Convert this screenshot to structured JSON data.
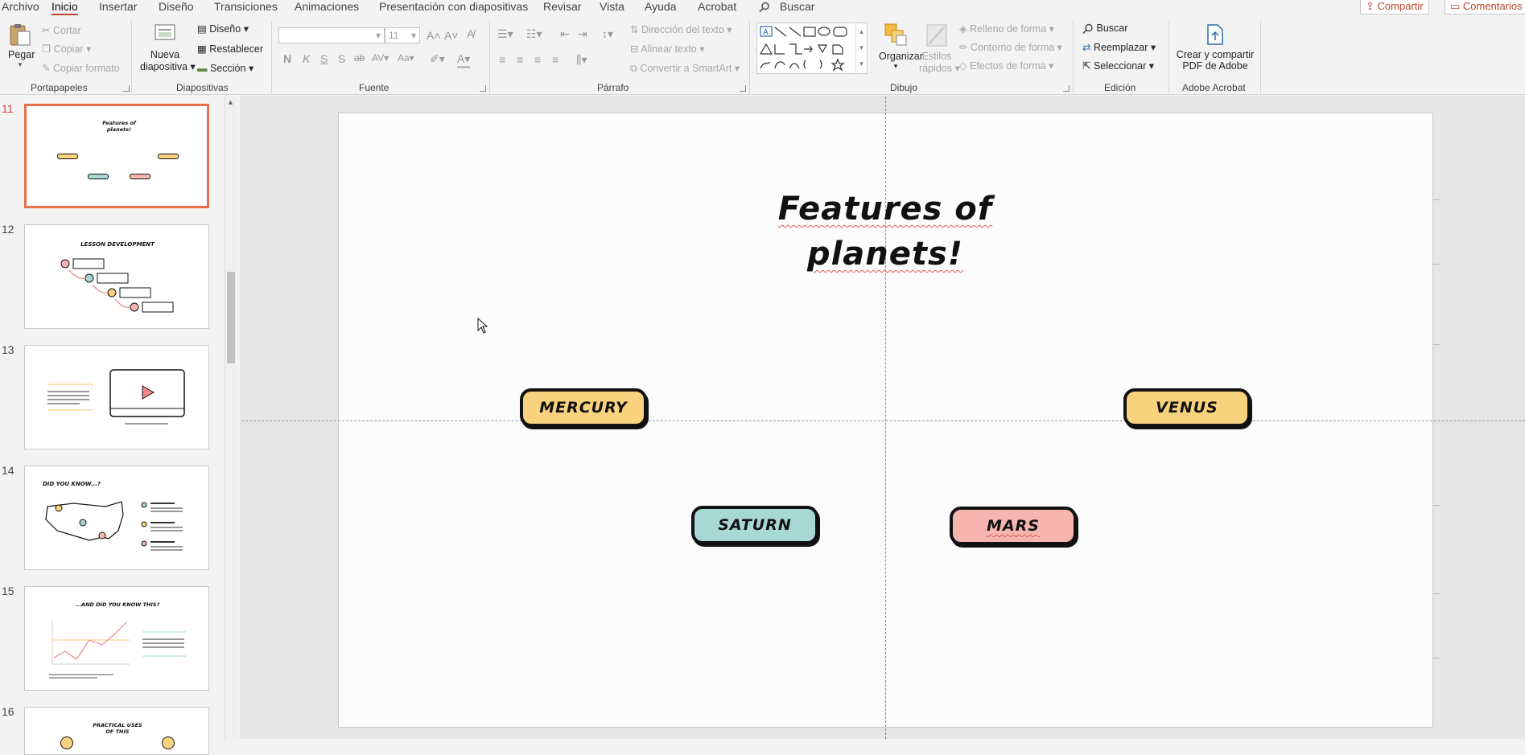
{
  "menu": {
    "tabs": [
      "Archivo",
      "Inicio",
      "Insertar",
      "Diseño",
      "Transiciones",
      "Animaciones",
      "Presentación con diapositivas",
      "Revisar",
      "Vista",
      "Ayuda",
      "Acrobat"
    ],
    "active_tab": "Inicio",
    "search_label": "Buscar",
    "share_label": "Compartir",
    "comments_label": "Comentarios"
  },
  "ribbon": {
    "clipboard": {
      "paste": "Pegar",
      "cut": "Cortar",
      "copy": "Copiar",
      "format_painter": "Copiar formato",
      "label": "Portapapeles"
    },
    "slides": {
      "new_slide_1": "Nueva",
      "new_slide_2": "diapositiva",
      "layout": "Diseño",
      "reset": "Restablecer",
      "section": "Sección",
      "label": "Diapositivas"
    },
    "font": {
      "name": "",
      "size": "11",
      "label": "Fuente"
    },
    "paragraph": {
      "text_direction": "Dirección del texto",
      "align_text": "Alinear texto",
      "smartart": "Convertir a SmartArt",
      "label": "Párrafo"
    },
    "drawing": {
      "arrange": "Organizar",
      "quick_styles_1": "Estilos",
      "quick_styles_2": "rápidos",
      "shape_fill": "Relleno de forma",
      "shape_outline": "Contorno de forma",
      "shape_effects": "Efectos de forma",
      "label": "Dibujo"
    },
    "editing": {
      "find": "Buscar",
      "replace": "Reemplazar",
      "select": "Seleccionar",
      "label": "Edición"
    },
    "acrobat": {
      "create_1": "Crear y compartir",
      "create_2": "PDF de Adobe",
      "label": "Adobe Acrobat"
    }
  },
  "slides_panel": {
    "numbers": [
      "11",
      "12",
      "13",
      "14",
      "15",
      "16"
    ],
    "selected": "11",
    "thumbs": {
      "s11_title": "Features of planets!",
      "s12_title": "LESSON DEVELOPMENT",
      "s14_title": "DID YOU KNOW...?",
      "s15_title": "...AND DID YOU KNOW THIS?",
      "s16_title": "PRACTICAL USES OF THIS"
    }
  },
  "slide": {
    "title_line1": "Features of",
    "title_line2": "planets!",
    "pills": [
      {
        "label": "MERCURY",
        "color": "#f9d27e"
      },
      {
        "label": "VENUS",
        "color": "#f9d27e"
      },
      {
        "label": "SATURN",
        "color": "#a8d8d4"
      },
      {
        "label": "MARS",
        "color": "#f6b5b1"
      }
    ]
  },
  "colors": {
    "accent": "#b7472a",
    "selection": "#e8704a"
  }
}
